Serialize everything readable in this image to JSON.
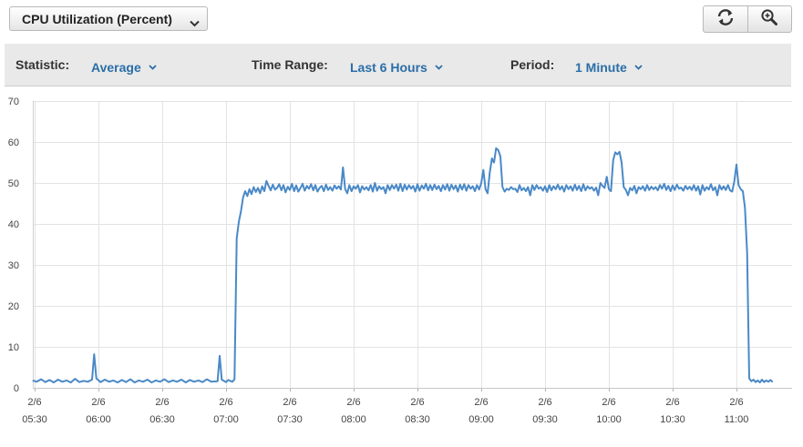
{
  "header": {
    "metric_label": "CPU Utilization (Percent)",
    "refresh_icon": "refresh-icon",
    "zoom_icon": "zoom-in-icon"
  },
  "toolbar": {
    "statistic_label": "Statistic:",
    "statistic_value": "Average",
    "time_range_label": "Time Range:",
    "time_range_value": "Last 6 Hours",
    "period_label": "Period:",
    "period_value": "1 Minute"
  },
  "colors": {
    "series": "#4a89c7",
    "link": "#2a6ea8",
    "grid": "#e3e3e3"
  },
  "chart_data": {
    "type": "line",
    "y_ticks": [
      0,
      10,
      20,
      30,
      40,
      50,
      60,
      70
    ],
    "ylim": [
      0,
      70
    ],
    "xlim": [
      0,
      348
    ],
    "grid": true,
    "x_ticks": [
      {
        "minute": 0,
        "date": "2/6",
        "time": "05:30"
      },
      {
        "minute": 30,
        "date": "2/6",
        "time": "06:00"
      },
      {
        "minute": 60,
        "date": "2/6",
        "time": "06:30"
      },
      {
        "minute": 90,
        "date": "2/6",
        "time": "07:00"
      },
      {
        "minute": 120,
        "date": "2/6",
        "time": "07:30"
      },
      {
        "minute": 150,
        "date": "2/6",
        "time": "08:00"
      },
      {
        "minute": 180,
        "date": "2/6",
        "time": "08:30"
      },
      {
        "minute": 210,
        "date": "2/6",
        "time": "09:00"
      },
      {
        "minute": 240,
        "date": "2/6",
        "time": "09:30"
      },
      {
        "minute": 270,
        "date": "2/6",
        "time": "10:00"
      },
      {
        "minute": 300,
        "date": "2/6",
        "time": "10:30"
      },
      {
        "minute": 330,
        "date": "2/6",
        "time": "11:00"
      }
    ],
    "series": [
      {
        "points": [
          [
            -1,
            1.8
          ],
          [
            1,
            1.5
          ],
          [
            3,
            2.1
          ],
          [
            5,
            1.4
          ],
          [
            7,
            1.9
          ],
          [
            9,
            1.3
          ],
          [
            11,
            2.0
          ],
          [
            13,
            1.5
          ],
          [
            15,
            1.8
          ],
          [
            17,
            1.3
          ],
          [
            19,
            2.2
          ],
          [
            21,
            1.4
          ],
          [
            23,
            1.7
          ],
          [
            25,
            1.5
          ],
          [
            27,
            2.0
          ],
          [
            28,
            8.2
          ],
          [
            29,
            2.3
          ],
          [
            31,
            1.4
          ],
          [
            33,
            2.0
          ],
          [
            35,
            1.5
          ],
          [
            37,
            1.8
          ],
          [
            39,
            1.3
          ],
          [
            41,
            1.9
          ],
          [
            43,
            1.4
          ],
          [
            45,
            2.1
          ],
          [
            47,
            1.3
          ],
          [
            49,
            1.8
          ],
          [
            51,
            1.5
          ],
          [
            53,
            2.0
          ],
          [
            55,
            1.3
          ],
          [
            57,
            1.8
          ],
          [
            59,
            1.5
          ],
          [
            61,
            2.1
          ],
          [
            63,
            1.4
          ],
          [
            65,
            1.8
          ],
          [
            67,
            1.5
          ],
          [
            69,
            2.0
          ],
          [
            71,
            1.3
          ],
          [
            73,
            1.9
          ],
          [
            75,
            1.5
          ],
          [
            77,
            1.8
          ],
          [
            79,
            1.4
          ],
          [
            81,
            2.1
          ],
          [
            83,
            1.5
          ],
          [
            86,
            1.6
          ],
          [
            87,
            7.8
          ],
          [
            88,
            2.0
          ],
          [
            90,
            1.4
          ],
          [
            91,
            1.9
          ],
          [
            93,
            1.5
          ],
          [
            94,
            2.1
          ],
          [
            95,
            36.5
          ],
          [
            96,
            40.5
          ],
          [
            97,
            43
          ],
          [
            98,
            46.5
          ],
          [
            99,
            48
          ],
          [
            100,
            46.8
          ],
          [
            101,
            48.5
          ],
          [
            102,
            47.3
          ],
          [
            103,
            49
          ],
          [
            104,
            47.8
          ],
          [
            105,
            48.8
          ],
          [
            106,
            47.5
          ],
          [
            107,
            49.2
          ],
          [
            108,
            48
          ],
          [
            109,
            50.5
          ],
          [
            110,
            49.3
          ],
          [
            111,
            48.2
          ],
          [
            112,
            49.6
          ],
          [
            113,
            48.4
          ],
          [
            114,
            48.8
          ],
          [
            115,
            49.7
          ],
          [
            116,
            48.2
          ],
          [
            117,
            49.5
          ],
          [
            118,
            47.7
          ],
          [
            119,
            49.1
          ],
          [
            120,
            48.3
          ],
          [
            121,
            49.8
          ],
          [
            122,
            48
          ],
          [
            123,
            49.4
          ],
          [
            124,
            47.9
          ],
          [
            125,
            48.8
          ],
          [
            126,
            49.8
          ],
          [
            127,
            48.1
          ],
          [
            128,
            49.3
          ],
          [
            129,
            48.6
          ],
          [
            130,
            49.7
          ],
          [
            131,
            48.2
          ],
          [
            132,
            49.5
          ],
          [
            133,
            47.9
          ],
          [
            134,
            48.8
          ],
          [
            135,
            49.3
          ],
          [
            136,
            48
          ],
          [
            137,
            49.6
          ],
          [
            138,
            48.3
          ],
          [
            139,
            49
          ],
          [
            140,
            48.1
          ],
          [
            141,
            49.4
          ],
          [
            142,
            48.6
          ],
          [
            143,
            49.2
          ],
          [
            144,
            48.4
          ],
          [
            145,
            53.8
          ],
          [
            146,
            48.5
          ],
          [
            147,
            47.5
          ],
          [
            148,
            49.5
          ],
          [
            149,
            48
          ],
          [
            150,
            49.2
          ],
          [
            151,
            48.6
          ],
          [
            152,
            49.5
          ],
          [
            153,
            47.7
          ],
          [
            154,
            49.2
          ],
          [
            155,
            48.4
          ],
          [
            156,
            49
          ],
          [
            157,
            48.2
          ],
          [
            158,
            49.5
          ],
          [
            159,
            47.9
          ],
          [
            160,
            50
          ],
          [
            161,
            48.1
          ],
          [
            162,
            49.2
          ],
          [
            163,
            48.5
          ],
          [
            164,
            49
          ],
          [
            165,
            47.5
          ],
          [
            166,
            49.5
          ],
          [
            167,
            48.3
          ],
          [
            168,
            49.5
          ],
          [
            169,
            48.6
          ],
          [
            170,
            49.6
          ],
          [
            171,
            48.1
          ],
          [
            172,
            49.8
          ],
          [
            173,
            48
          ],
          [
            174,
            49.6
          ],
          [
            175,
            48.4
          ],
          [
            176,
            49.5
          ],
          [
            177,
            48.6
          ],
          [
            178,
            49.3
          ],
          [
            179,
            47.9
          ],
          [
            180,
            49.7
          ],
          [
            181,
            48.1
          ],
          [
            182,
            49.4
          ],
          [
            183,
            48.6
          ],
          [
            184,
            49.8
          ],
          [
            185,
            48.2
          ],
          [
            186,
            49.5
          ],
          [
            187,
            48.3
          ],
          [
            188,
            49.6
          ],
          [
            189,
            48.5
          ],
          [
            190,
            49.3
          ],
          [
            191,
            48
          ],
          [
            192,
            49.5
          ],
          [
            193,
            48.4
          ],
          [
            194,
            49.7
          ],
          [
            195,
            48.1
          ],
          [
            196,
            49.6
          ],
          [
            197,
            48.5
          ],
          [
            198,
            49.4
          ],
          [
            199,
            47.9
          ],
          [
            200,
            49.6
          ],
          [
            201,
            48.4
          ],
          [
            202,
            49.7
          ],
          [
            203,
            48.1
          ],
          [
            204,
            49.5
          ],
          [
            205,
            48.6
          ],
          [
            206,
            49.2
          ],
          [
            207,
            48
          ],
          [
            208,
            49.5
          ],
          [
            209,
            48.4
          ],
          [
            210,
            50
          ],
          [
            211,
            53.2
          ],
          [
            212,
            48.5
          ],
          [
            213,
            47.5
          ],
          [
            214,
            52.5
          ],
          [
            215,
            56
          ],
          [
            216,
            55
          ],
          [
            217,
            58.5
          ],
          [
            218,
            58
          ],
          [
            219,
            56.5
          ],
          [
            220,
            49
          ],
          [
            221,
            47.9
          ],
          [
            222,
            48.6
          ],
          [
            223,
            48.3
          ],
          [
            224,
            49
          ],
          [
            225,
            48.5
          ],
          [
            226,
            48.6
          ],
          [
            227,
            47.8
          ],
          [
            228,
            49.5
          ],
          [
            229,
            48.2
          ],
          [
            230,
            48.8
          ],
          [
            231,
            48
          ],
          [
            232,
            49
          ],
          [
            233,
            47
          ],
          [
            234,
            49.5
          ],
          [
            235,
            48.3
          ],
          [
            236,
            49.5
          ],
          [
            237,
            48.6
          ],
          [
            238,
            49
          ],
          [
            239,
            48.1
          ],
          [
            240,
            49.2
          ],
          [
            241,
            47.8
          ],
          [
            242,
            49.5
          ],
          [
            243,
            48.2
          ],
          [
            244,
            49.2
          ],
          [
            245,
            48.5
          ],
          [
            246,
            49.6
          ],
          [
            247,
            48.4
          ],
          [
            248,
            49.2
          ],
          [
            249,
            47.9
          ],
          [
            250,
            49.5
          ],
          [
            251,
            48.5
          ],
          [
            252,
            49.2
          ],
          [
            253,
            48.1
          ],
          [
            254,
            49.6
          ],
          [
            255,
            48.3
          ],
          [
            256,
            49.3
          ],
          [
            257,
            48
          ],
          [
            258,
            49.7
          ],
          [
            259,
            48.2
          ],
          [
            260,
            49.2
          ],
          [
            261,
            48.6
          ],
          [
            262,
            49
          ],
          [
            263,
            48.1
          ],
          [
            264,
            48.9
          ],
          [
            265,
            47
          ],
          [
            266,
            50
          ],
          [
            267,
            49.3
          ],
          [
            268,
            48.8
          ],
          [
            269,
            51.5
          ],
          [
            270,
            48.5
          ],
          [
            271,
            48
          ],
          [
            272,
            55.5
          ],
          [
            273,
            57.5
          ],
          [
            274,
            57
          ],
          [
            275,
            57.6
          ],
          [
            276,
            55
          ],
          [
            277,
            49
          ],
          [
            278,
            48.3
          ],
          [
            279,
            47
          ],
          [
            280,
            48.8
          ],
          [
            281,
            48.2
          ],
          [
            282,
            49.3
          ],
          [
            283,
            47.5
          ],
          [
            284,
            49
          ],
          [
            285,
            48.5
          ],
          [
            286,
            49.2
          ],
          [
            287,
            48.1
          ],
          [
            288,
            49.5
          ],
          [
            289,
            48.3
          ],
          [
            290,
            49.1
          ],
          [
            291,
            48.5
          ],
          [
            292,
            49
          ],
          [
            293,
            48.2
          ],
          [
            294,
            49.5
          ],
          [
            295,
            48.6
          ],
          [
            296,
            49.8
          ],
          [
            297,
            48.3
          ],
          [
            298,
            49.3
          ],
          [
            299,
            48
          ],
          [
            300,
            49.4
          ],
          [
            301,
            48.3
          ],
          [
            302,
            49.6
          ],
          [
            303,
            48.6
          ],
          [
            304,
            48.9
          ],
          [
            305,
            48.1
          ],
          [
            306,
            49.3
          ],
          [
            307,
            48.5
          ],
          [
            308,
            49.1
          ],
          [
            309,
            48.3
          ],
          [
            310,
            49.5
          ],
          [
            311,
            48.1
          ],
          [
            312,
            49.2
          ],
          [
            313,
            47.2
          ],
          [
            314,
            49.5
          ],
          [
            315,
            48.1
          ],
          [
            316,
            49
          ],
          [
            317,
            48.4
          ],
          [
            318,
            49.7
          ],
          [
            319,
            48.2
          ],
          [
            320,
            49
          ],
          [
            321,
            47
          ],
          [
            322,
            49.5
          ],
          [
            323,
            48.4
          ],
          [
            324,
            49.2
          ],
          [
            325,
            48.3
          ],
          [
            326,
            49.5
          ],
          [
            327,
            48.2
          ],
          [
            328,
            47.9
          ],
          [
            329,
            50.5
          ],
          [
            330,
            54.5
          ],
          [
            331,
            49.5
          ],
          [
            332,
            48.5
          ],
          [
            333,
            48
          ],
          [
            334,
            44
          ],
          [
            335,
            33
          ],
          [
            336,
            2.3
          ],
          [
            337,
            1.6
          ],
          [
            338,
            2.0
          ],
          [
            339,
            1.4
          ],
          [
            340,
            1.8
          ],
          [
            341,
            1.3
          ],
          [
            342,
            2.0
          ],
          [
            343,
            1.4
          ],
          [
            344,
            1.8
          ],
          [
            345,
            1.5
          ],
          [
            346,
            1.9
          ],
          [
            347,
            1.4
          ]
        ]
      }
    ]
  }
}
